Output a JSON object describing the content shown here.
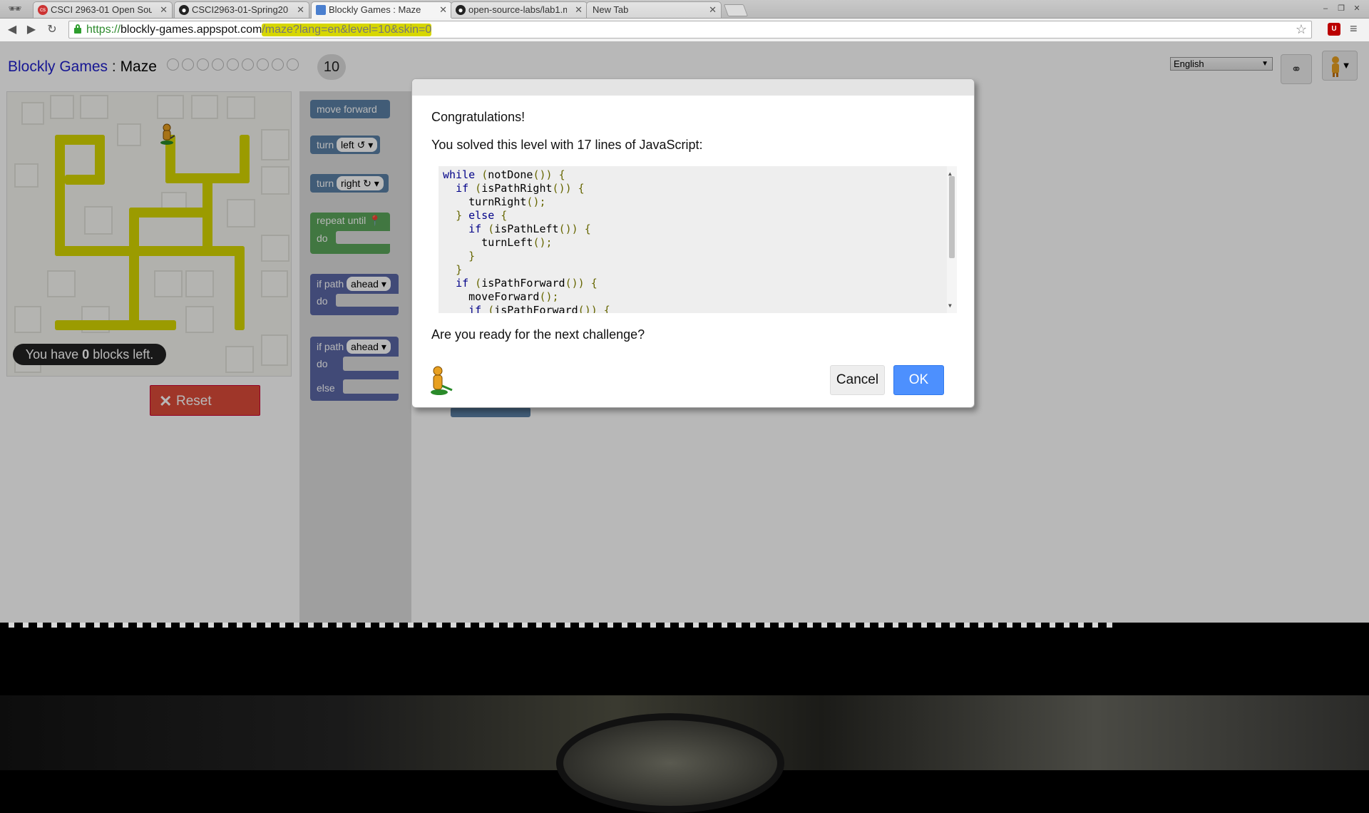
{
  "browser": {
    "tabs": [
      {
        "title": "CSCI 2963-01 Open Sour",
        "icon": "cs-favicon"
      },
      {
        "title": "CSCI2963-01-Spring201",
        "icon": "github-favicon"
      },
      {
        "title": "Blockly Games : Maze",
        "icon": "blockly-favicon"
      },
      {
        "title": "open-source-labs/lab1.m",
        "icon": "github-favicon"
      },
      {
        "title": "New Tab",
        "icon": ""
      }
    ],
    "url_scheme": "https://",
    "url_host": "blockly-games.appspot.com",
    "url_path": "/maze?lang=en&level=10&skin=0",
    "extension_badge": "U"
  },
  "header": {
    "app_name": "Blockly Games",
    "separator": " : ",
    "game_name": "Maze",
    "current_level": "10",
    "language": "English"
  },
  "maze": {
    "blocks_left_prefix": "You have ",
    "blocks_left_count": "0",
    "blocks_left_suffix": " blocks left."
  },
  "reset_label": "Reset",
  "toolbox": {
    "move_forward": "move forward",
    "turn": "turn",
    "left": "left ↺ ▾",
    "right": "right ↻ ▾",
    "repeat_until": "repeat until",
    "do": "do",
    "if_path": "if path",
    "ahead": "ahead ▾",
    "else": "else"
  },
  "dialog": {
    "congrats": "Congratulations!",
    "solved": "You solved this level with 17 lines of JavaScript:",
    "question": "Are you ready for the next challenge?",
    "cancel": "Cancel",
    "ok": "OK",
    "code_lines": [
      "while (notDone()) {",
      "  if (isPathRight()) {",
      "    turnRight();",
      "  } else {",
      "    if (isPathLeft()) {",
      "      turnLeft();",
      "    }",
      "  }",
      "  if (isPathForward()) {",
      "    moveForward();",
      "    if (isPathForward()) {"
    ]
  },
  "colors": {
    "path": "#d7d700",
    "reset": "#dd4b39",
    "ok": "#4d90fe",
    "link": "#2020cc"
  }
}
